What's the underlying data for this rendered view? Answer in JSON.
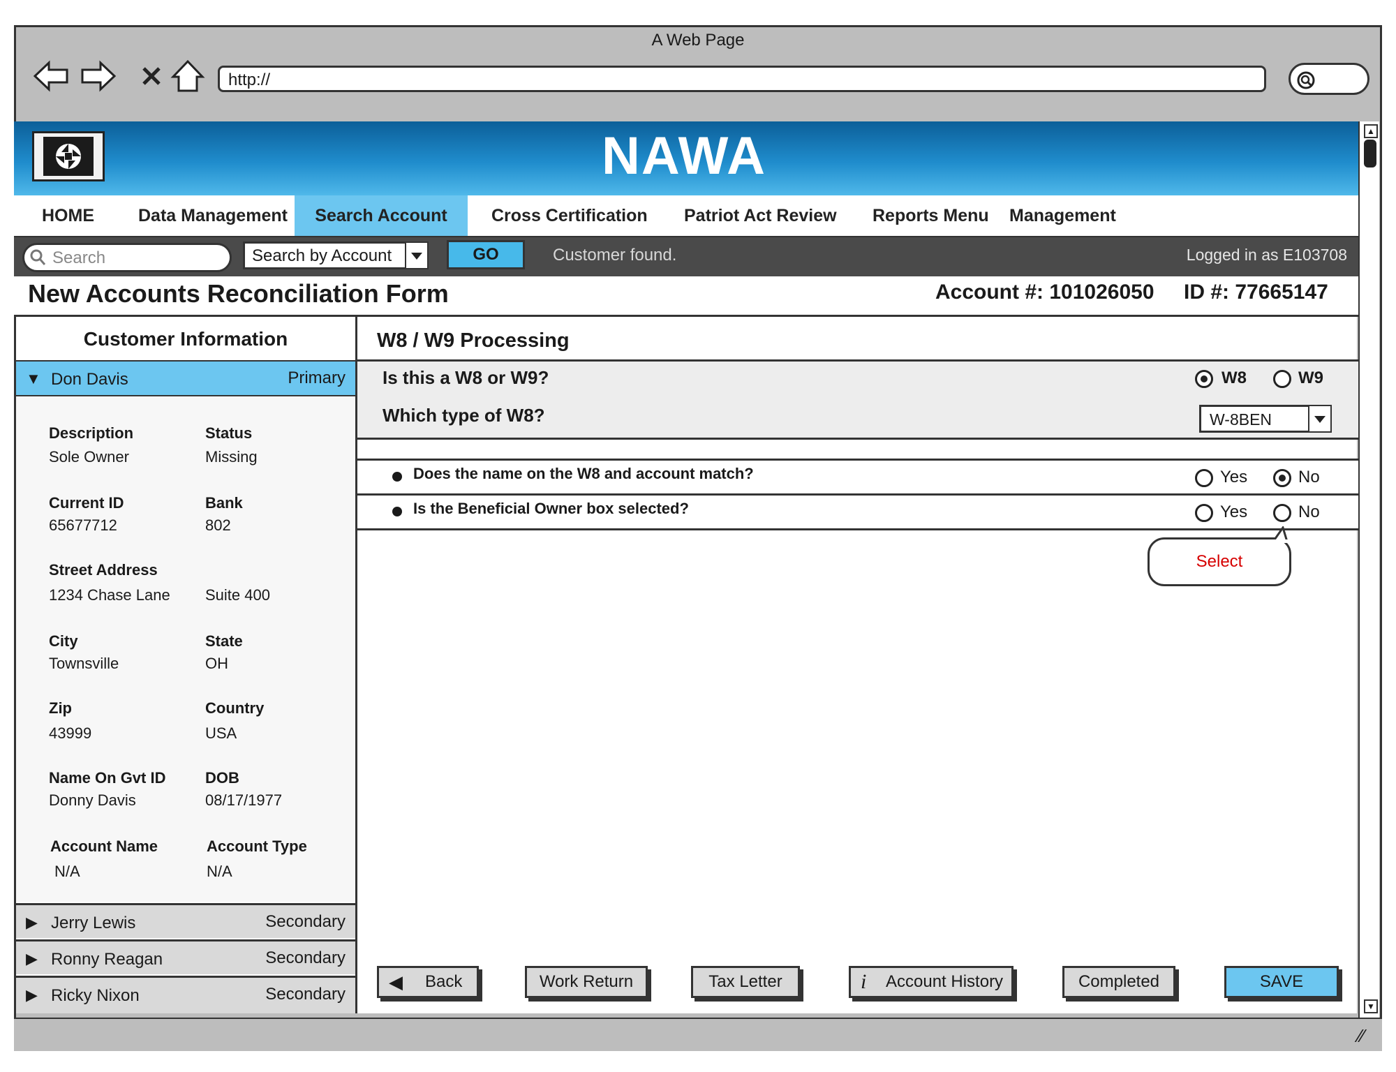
{
  "browser": {
    "title": "A Web Page",
    "url": "http://"
  },
  "header": {
    "brand": "NAWA"
  },
  "menu": [
    {
      "label": "HOME",
      "active": false
    },
    {
      "label": "Data Management",
      "active": false
    },
    {
      "label": "Search Account",
      "active": true
    },
    {
      "label": "Cross Certification",
      "active": false
    },
    {
      "label": "Patriot Act Review",
      "active": false
    },
    {
      "label": "Reports Menu",
      "active": false
    },
    {
      "label": "Management",
      "active": false
    }
  ],
  "toolbar": {
    "search_placeholder": "Search",
    "search_by": "Search by Account",
    "go_label": "GO",
    "status": "Customer found.",
    "logged_in": "Logged in as E103708"
  },
  "form": {
    "title": "New Accounts Reconciliation Form",
    "account": "Account #: 101026050",
    "id": "ID #: 77665147"
  },
  "customer_info": {
    "heading": "Customer Information",
    "primary": {
      "name": "Don Davis",
      "role": "Primary"
    },
    "fields": [
      {
        "label": "Description",
        "value": "Sole Owner"
      },
      {
        "label": "Status",
        "value": "Missing"
      },
      {
        "label": "Current ID",
        "value": "65677712"
      },
      {
        "label": "Bank",
        "value": "802"
      },
      {
        "label": "Street Address",
        "value": "1234 Chase Lane"
      },
      {
        "label": "",
        "value": "Suite 400"
      },
      {
        "label": "City",
        "value": "Townsville"
      },
      {
        "label": "State",
        "value": "OH"
      },
      {
        "label": "Zip",
        "value": "43999"
      },
      {
        "label": "Country",
        "value": "USA"
      },
      {
        "label": "Name On Gvt ID",
        "value": "Donny Davis"
      },
      {
        "label": "DOB",
        "value": "08/17/1977"
      },
      {
        "label": "Account Name",
        "value": "N/A"
      },
      {
        "label": "Account Type",
        "value": "N/A"
      }
    ],
    "secondary": [
      {
        "name": "Jerry Lewis",
        "role": "Secondary"
      },
      {
        "name": "Ronny Reagan",
        "role": "Secondary"
      },
      {
        "name": "Ricky Nixon",
        "role": "Secondary"
      }
    ]
  },
  "processing": {
    "heading": "W8 / W9 Processing",
    "q1": "Is this a W8 or W9?",
    "q1_options": [
      "W8",
      "W9"
    ],
    "q1_selected": "W8",
    "q2": "Which type of W8?",
    "q2_value": "W-8BEN",
    "checks": [
      {
        "text": "Does the name on the W8 and account match?",
        "yes": "Yes",
        "no": "No",
        "selected": "No"
      },
      {
        "text": "Is the Beneficial Owner box selected?",
        "yes": "Yes",
        "no": "No",
        "selected": ""
      }
    ],
    "tooltip": "Select"
  },
  "buttons": {
    "back": "Back",
    "work_return": "Work Return",
    "tax_letter": "Tax Letter",
    "account_history": "Account History",
    "completed": "Completed",
    "save": "SAVE"
  },
  "colors": {
    "accent": "#6cc6f0",
    "banner": "#1f8ccc",
    "toolbar": "#4a4a4a",
    "tooltip_text": "#d60000"
  }
}
